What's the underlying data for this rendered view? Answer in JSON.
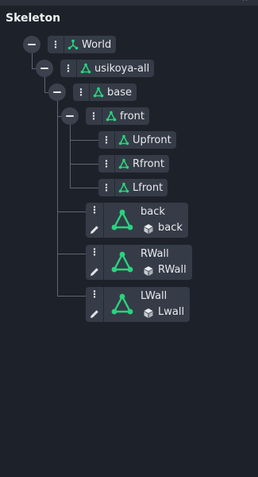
{
  "panel": {
    "title": "Skeleton"
  },
  "colors": {
    "accent": "#29d37f",
    "background": "#1d222a",
    "item_bg": "#353c47"
  },
  "topbar": {
    "icons": [
      "collapse-icon",
      "close-icon"
    ],
    "glyphs": [
      "‹‹",
      "×"
    ]
  },
  "tree": {
    "world": {
      "label": "World",
      "icon": "root-bone-icon"
    },
    "usikoya_all": {
      "label": "usikoya-all",
      "icon": "bone-icon"
    },
    "base": {
      "label": "base",
      "icon": "bone-icon"
    },
    "front": {
      "label": "front",
      "icon": "bone-icon"
    },
    "upfront": {
      "label": "Upfront",
      "icon": "bone-icon"
    },
    "rfront": {
      "label": "Rfront",
      "icon": "bone-icon"
    },
    "lfront": {
      "label": "Lfront",
      "icon": "bone-icon"
    },
    "back": {
      "label": "back",
      "mesh": "back",
      "icon": "bone-icon"
    },
    "rwall": {
      "label": "RWall",
      "mesh": "RWall",
      "icon": "bone-icon"
    },
    "lwall": {
      "label": "LWall",
      "mesh": "Lwall",
      "icon": "bone-icon"
    }
  },
  "menu_glyph": "⋮"
}
